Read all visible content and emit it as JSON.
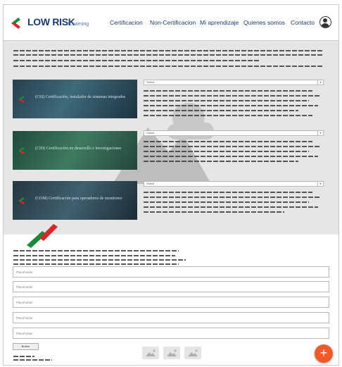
{
  "brand": {
    "name": "LOW RISK",
    "sub": "eLearning"
  },
  "nav": [
    "Certificacion",
    "Non-Certificacion",
    "Mi aprendizaje",
    "Quienes somos",
    "Contacto"
  ],
  "courses": [
    {
      "title": "(CSI) Certificación, instalador de sistemas integrados",
      "select": "Select"
    },
    {
      "title": "(CDI) Certificación en desarrollo e investigaciones",
      "select": "Select"
    },
    {
      "title": "(COM) Certificación para operadores de monitoreo",
      "select": "Select"
    }
  ],
  "form": {
    "placeholders": [
      "Placeholder",
      "Placeholder",
      "Placeholder",
      "Placeholder",
      "Placeholder"
    ],
    "button": "Button"
  },
  "fab": "+",
  "colors": {
    "brand_navy": "#1e3a6b",
    "brand_green": "#1a8a3c",
    "brand_red": "#d9262b",
    "fab": "#f05a28",
    "band": "#e6e6e6"
  },
  "icons": [
    "user-avatar-icon",
    "image-add-icon",
    "plus-icon",
    "logo-mark"
  ]
}
